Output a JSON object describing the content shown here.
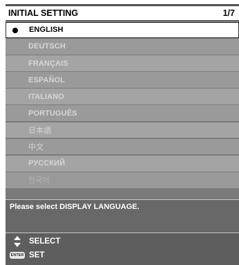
{
  "header": {
    "title": "INITIAL SETTING",
    "page": "1/7"
  },
  "languages": [
    "ENGLISH",
    "DEUTSCH",
    "FRANÇAIS",
    "ESPAÑOL",
    "ITALIANO",
    "PORTUGUÊS",
    "日本語",
    "中文",
    "РУССКИЙ",
    "한국어"
  ],
  "selected_language": "ENGLISH",
  "message": "Please select DISPLAY LANGUAGE.",
  "hints": {
    "select_label": "SELECT",
    "set_label": "SET",
    "enter_key_text": "ENTER"
  },
  "icons": {
    "select": "up-down-arrows-icon",
    "set": "enter-key-icon",
    "selected_marker": "filled-dot-icon"
  },
  "colors": {
    "panel": "#7a7a7a",
    "selected_bg": "#ffffff",
    "item_text": "#d6d6d6"
  }
}
